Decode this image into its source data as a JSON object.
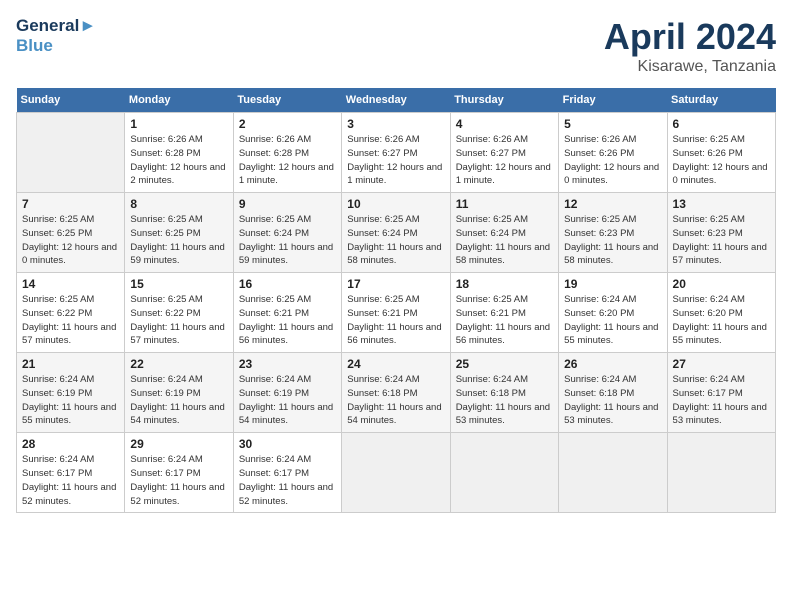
{
  "header": {
    "logo_line1": "General",
    "logo_line2": "Blue",
    "month": "April 2024",
    "location": "Kisarawe, Tanzania"
  },
  "days_of_week": [
    "Sunday",
    "Monday",
    "Tuesday",
    "Wednesday",
    "Thursday",
    "Friday",
    "Saturday"
  ],
  "weeks": [
    [
      {
        "day": "",
        "empty": true
      },
      {
        "day": "1",
        "sunrise": "6:26 AM",
        "sunset": "6:28 PM",
        "daylight": "12 hours and 2 minutes."
      },
      {
        "day": "2",
        "sunrise": "6:26 AM",
        "sunset": "6:28 PM",
        "daylight": "12 hours and 1 minute."
      },
      {
        "day": "3",
        "sunrise": "6:26 AM",
        "sunset": "6:27 PM",
        "daylight": "12 hours and 1 minute."
      },
      {
        "day": "4",
        "sunrise": "6:26 AM",
        "sunset": "6:27 PM",
        "daylight": "12 hours and 1 minute."
      },
      {
        "day": "5",
        "sunrise": "6:26 AM",
        "sunset": "6:26 PM",
        "daylight": "12 hours and 0 minutes."
      },
      {
        "day": "6",
        "sunrise": "6:25 AM",
        "sunset": "6:26 PM",
        "daylight": "12 hours and 0 minutes."
      }
    ],
    [
      {
        "day": "7",
        "sunrise": "6:25 AM",
        "sunset": "6:25 PM",
        "daylight": "12 hours and 0 minutes."
      },
      {
        "day": "8",
        "sunrise": "6:25 AM",
        "sunset": "6:25 PM",
        "daylight": "11 hours and 59 minutes."
      },
      {
        "day": "9",
        "sunrise": "6:25 AM",
        "sunset": "6:24 PM",
        "daylight": "11 hours and 59 minutes."
      },
      {
        "day": "10",
        "sunrise": "6:25 AM",
        "sunset": "6:24 PM",
        "daylight": "11 hours and 58 minutes."
      },
      {
        "day": "11",
        "sunrise": "6:25 AM",
        "sunset": "6:24 PM",
        "daylight": "11 hours and 58 minutes."
      },
      {
        "day": "12",
        "sunrise": "6:25 AM",
        "sunset": "6:23 PM",
        "daylight": "11 hours and 58 minutes."
      },
      {
        "day": "13",
        "sunrise": "6:25 AM",
        "sunset": "6:23 PM",
        "daylight": "11 hours and 57 minutes."
      }
    ],
    [
      {
        "day": "14",
        "sunrise": "6:25 AM",
        "sunset": "6:22 PM",
        "daylight": "11 hours and 57 minutes."
      },
      {
        "day": "15",
        "sunrise": "6:25 AM",
        "sunset": "6:22 PM",
        "daylight": "11 hours and 57 minutes."
      },
      {
        "day": "16",
        "sunrise": "6:25 AM",
        "sunset": "6:21 PM",
        "daylight": "11 hours and 56 minutes."
      },
      {
        "day": "17",
        "sunrise": "6:25 AM",
        "sunset": "6:21 PM",
        "daylight": "11 hours and 56 minutes."
      },
      {
        "day": "18",
        "sunrise": "6:25 AM",
        "sunset": "6:21 PM",
        "daylight": "11 hours and 56 minutes."
      },
      {
        "day": "19",
        "sunrise": "6:24 AM",
        "sunset": "6:20 PM",
        "daylight": "11 hours and 55 minutes."
      },
      {
        "day": "20",
        "sunrise": "6:24 AM",
        "sunset": "6:20 PM",
        "daylight": "11 hours and 55 minutes."
      }
    ],
    [
      {
        "day": "21",
        "sunrise": "6:24 AM",
        "sunset": "6:19 PM",
        "daylight": "11 hours and 55 minutes."
      },
      {
        "day": "22",
        "sunrise": "6:24 AM",
        "sunset": "6:19 PM",
        "daylight": "11 hours and 54 minutes."
      },
      {
        "day": "23",
        "sunrise": "6:24 AM",
        "sunset": "6:19 PM",
        "daylight": "11 hours and 54 minutes."
      },
      {
        "day": "24",
        "sunrise": "6:24 AM",
        "sunset": "6:18 PM",
        "daylight": "11 hours and 54 minutes."
      },
      {
        "day": "25",
        "sunrise": "6:24 AM",
        "sunset": "6:18 PM",
        "daylight": "11 hours and 53 minutes."
      },
      {
        "day": "26",
        "sunrise": "6:24 AM",
        "sunset": "6:18 PM",
        "daylight": "11 hours and 53 minutes."
      },
      {
        "day": "27",
        "sunrise": "6:24 AM",
        "sunset": "6:17 PM",
        "daylight": "11 hours and 53 minutes."
      }
    ],
    [
      {
        "day": "28",
        "sunrise": "6:24 AM",
        "sunset": "6:17 PM",
        "daylight": "11 hours and 52 minutes."
      },
      {
        "day": "29",
        "sunrise": "6:24 AM",
        "sunset": "6:17 PM",
        "daylight": "11 hours and 52 minutes."
      },
      {
        "day": "30",
        "sunrise": "6:24 AM",
        "sunset": "6:17 PM",
        "daylight": "11 hours and 52 minutes."
      },
      {
        "day": "",
        "empty": true
      },
      {
        "day": "",
        "empty": true
      },
      {
        "day": "",
        "empty": true
      },
      {
        "day": "",
        "empty": true
      }
    ]
  ]
}
